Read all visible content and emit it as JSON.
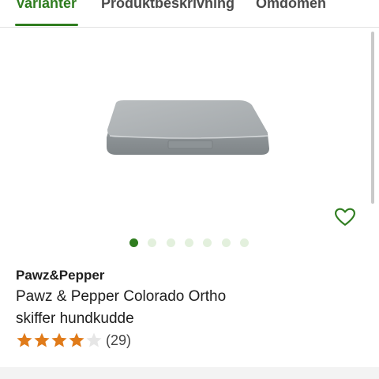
{
  "tabs": [
    {
      "label": "Varianter",
      "active": true
    },
    {
      "label": "Produktbeskrivning",
      "active": false
    },
    {
      "label": "Omdömen",
      "active": false
    }
  ],
  "gallery": {
    "image": "grey orthopedic dog cushion",
    "total_images": 7,
    "active_index": 0,
    "wishlist_icon": "heart-outline-icon"
  },
  "product": {
    "brand": "Pawz&Pepper",
    "title_line1": "Pawz & Pepper Colorado Ortho",
    "title_line2": "skiffer hundkudde",
    "rating": 4,
    "rating_max": 5,
    "review_count": "(29)"
  },
  "colors": {
    "accent": "#2f7d1f",
    "star": "#e07b1a",
    "star_empty": "#e6e6e6",
    "dot_inactive": "#e3f0dd"
  }
}
